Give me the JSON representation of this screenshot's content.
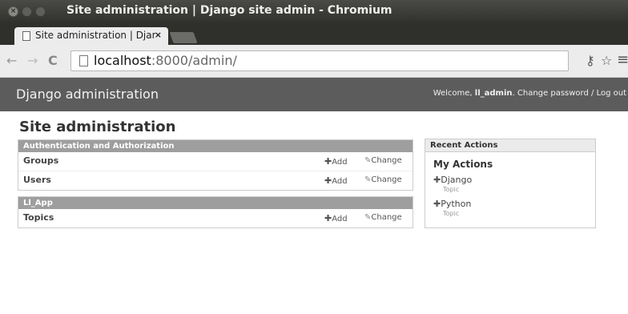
{
  "window": {
    "title": "Site administration | Django site admin - Chromium"
  },
  "browser": {
    "tab_title": "Site administration | Django site admin",
    "tab_close": "×",
    "url_host": "localhost",
    "url_rest": ":8000/admin/"
  },
  "header": {
    "brand": "Django administration",
    "welcome": "Welcome, ",
    "username": "ll_admin",
    "after_user": ". ",
    "change_password": "Change password",
    "separator": " / ",
    "logout": "Log out"
  },
  "content": {
    "title": "Site administration",
    "modules": [
      {
        "caption": "Authentication and Authorization",
        "rows": [
          {
            "name": "Groups",
            "add": "Add",
            "change": "Change"
          },
          {
            "name": "Users",
            "add": "Add",
            "change": "Change"
          }
        ]
      },
      {
        "caption": "Ll_App",
        "rows": [
          {
            "name": "Topics",
            "add": "Add",
            "change": "Change"
          }
        ]
      }
    ]
  },
  "recent": {
    "caption": "Recent Actions",
    "my_actions": "My Actions",
    "items": [
      {
        "name": "Django",
        "type": "Topic"
      },
      {
        "name": "Python",
        "type": "Topic"
      }
    ]
  },
  "icons": {
    "add": "plus-icon",
    "change": "pencil-icon"
  }
}
